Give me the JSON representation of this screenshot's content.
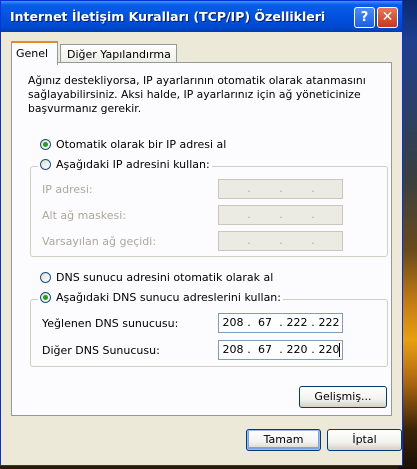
{
  "window": {
    "title": "Internet İletişim Kuralları (TCP/IP) Özellikleri",
    "help_label": "?",
    "close_label": "✕"
  },
  "tabs": [
    {
      "label": "Genel"
    },
    {
      "label": "Diğer Yapılandırma"
    }
  ],
  "intro_text": "Ağınız destekliyorsa, IP ayarlarının otomatik olarak atanmasını sağlayabilirsiniz. Aksi halde, IP ayarlarınız için ağ yöneticinize başvurmanız gerekir.",
  "ip": {
    "auto_label": "Otomatik olarak bir IP adresi al",
    "manual_label": "Aşağıdaki IP adresini kullan:",
    "fields": [
      {
        "label": "IP adresi:",
        "octets": [
          "",
          "",
          "",
          ""
        ]
      },
      {
        "label": "Alt ağ maskesi:",
        "octets": [
          "",
          "",
          "",
          ""
        ]
      },
      {
        "label": "Varsayılan ağ geçidi:",
        "octets": [
          "",
          "",
          "",
          ""
        ]
      }
    ]
  },
  "dns": {
    "auto_label": "DNS sunucu adresini otomatik olarak al",
    "manual_label": "Aşağıdaki DNS sunucu adreslerini kullan:",
    "fields": [
      {
        "label": "Yeğlenen DNS sunucusu:",
        "octets": [
          "208",
          "67",
          "222",
          "222"
        ]
      },
      {
        "label": "Diğer DNS Sunucusu:",
        "octets": [
          "208",
          "67",
          "220",
          "220"
        ]
      }
    ]
  },
  "buttons": {
    "advanced": "Gelişmiş...",
    "ok": "Tamam",
    "cancel": "İptal"
  },
  "selected": {
    "ip_mode": "auto",
    "dns_mode": "manual"
  }
}
